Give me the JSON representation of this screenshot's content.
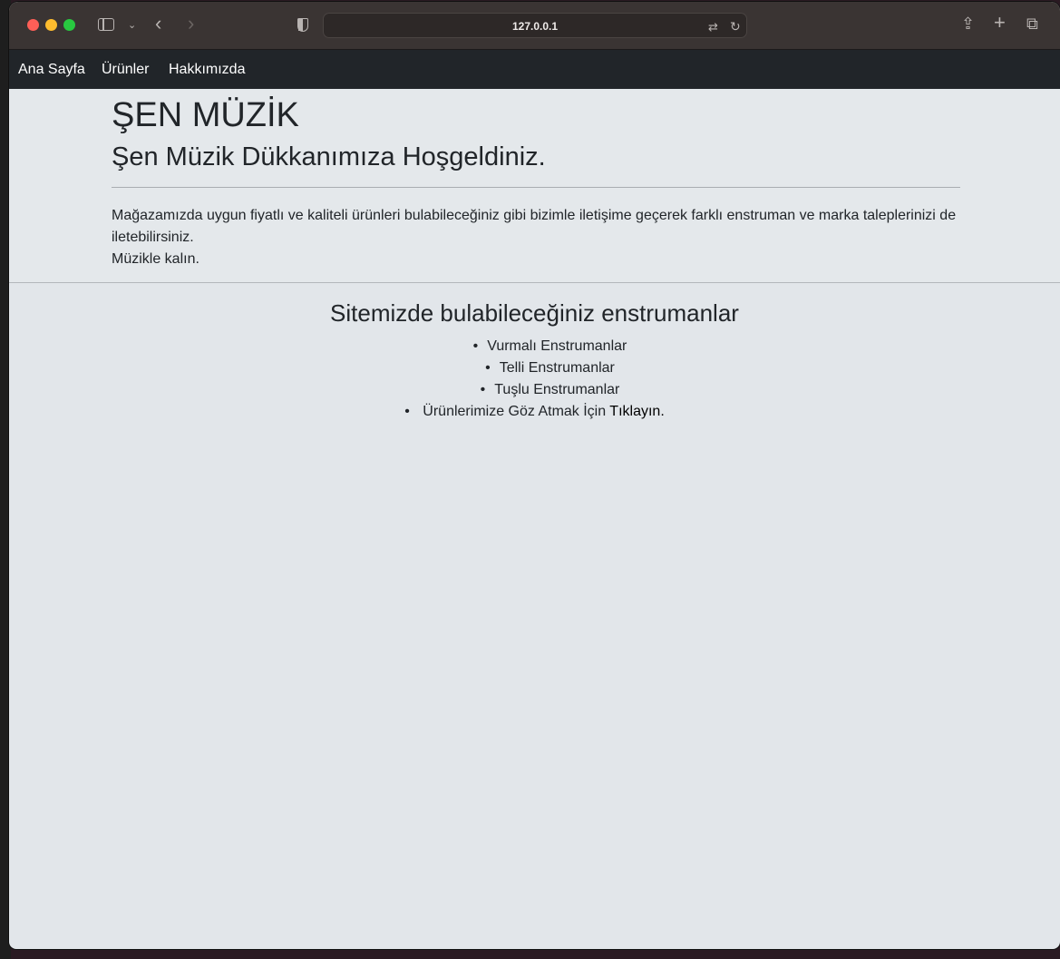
{
  "browser": {
    "url": "127.0.0.1"
  },
  "navbar": {
    "items": [
      "Ana Sayfa",
      "Ürünler",
      "Hakkımızda"
    ]
  },
  "hero": {
    "title": "ŞEN MÜZİK",
    "subtitle": "Şen Müzik Dükkanımıza Hoşgeldiniz.",
    "paragraph": "Mağazamızda uygun fiyatlı ve kaliteli ürünleri bulabileceğiniz gibi bizimle iletişime geçerek farklı enstruman ve marka taleplerinizi de iletebilirsiniz.",
    "closing": "Müzikle kalın."
  },
  "instruments": {
    "title": "Sitemizde bulabileceğiniz enstrumanlar",
    "items": [
      "Vurmalı Enstrumanlar",
      "Telli Enstrumanlar",
      "Tuşlu Enstrumanlar"
    ],
    "last_item_prefix": "Ürünlerimize Göz Atmak İçin ",
    "last_item_link": "Tıklayın."
  }
}
